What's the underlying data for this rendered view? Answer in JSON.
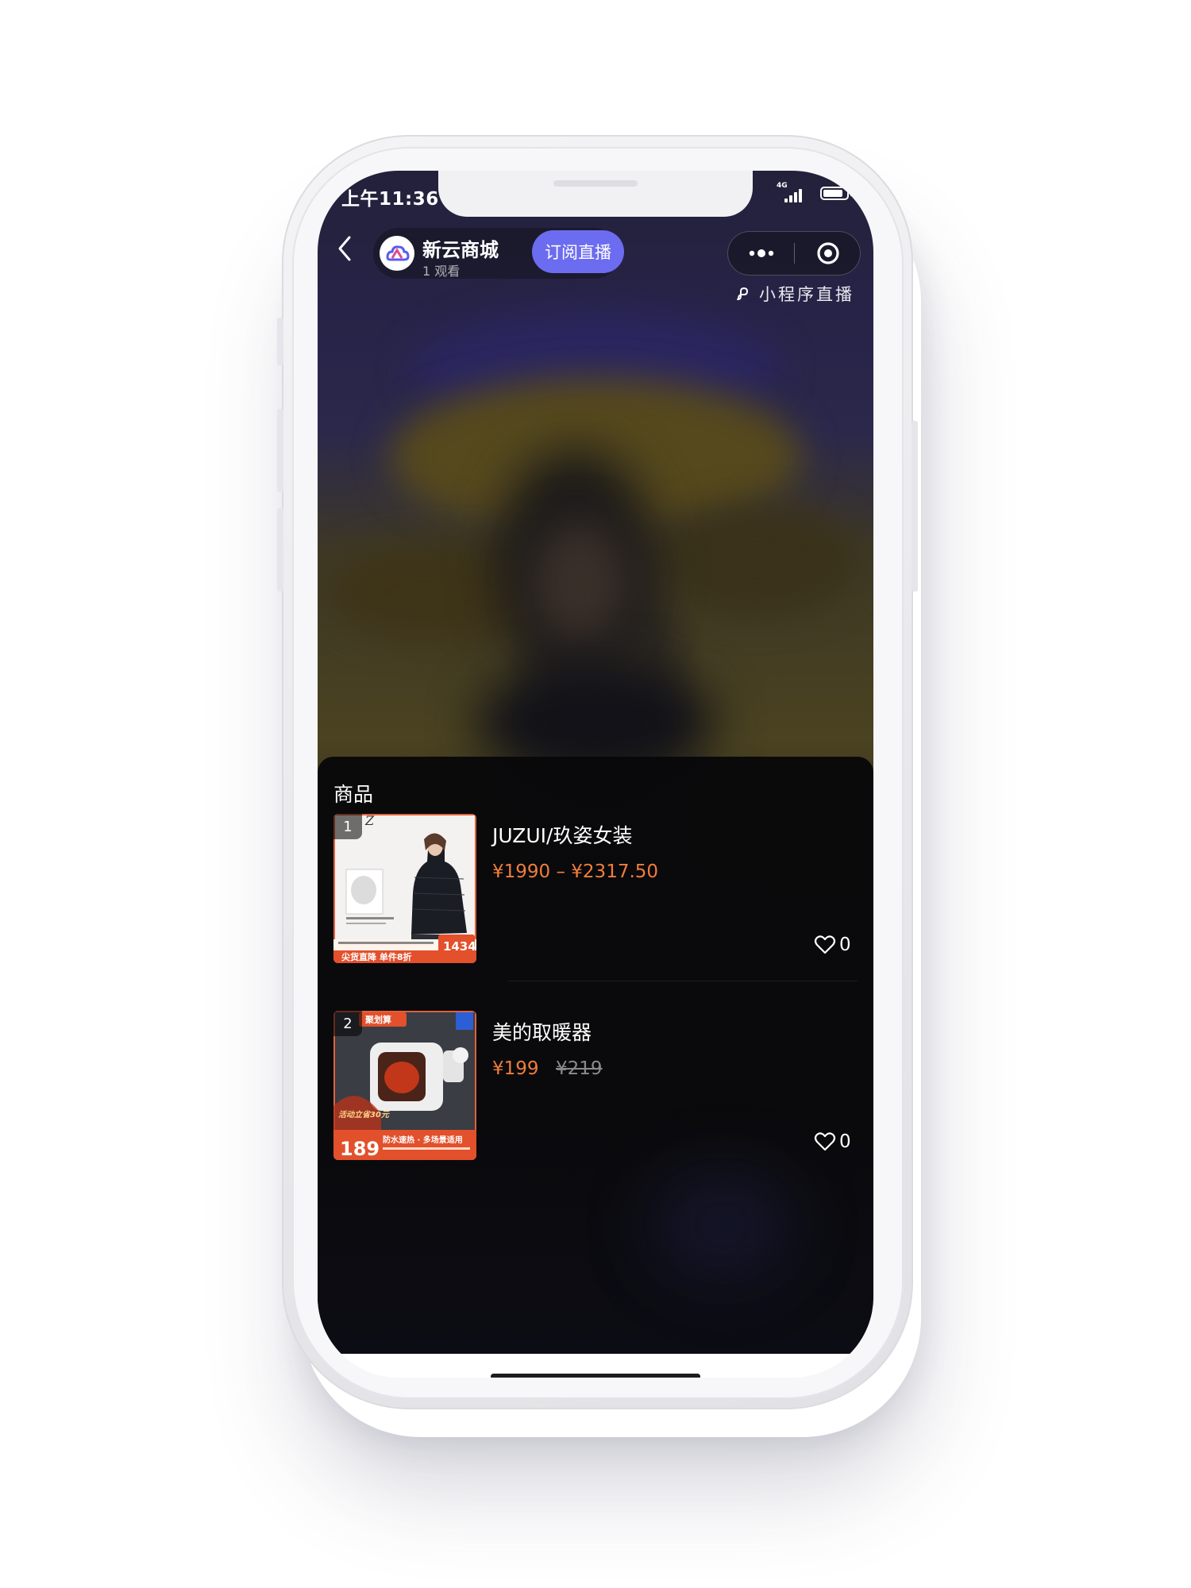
{
  "status_bar": {
    "time": "上午11:36",
    "network": "4G",
    "battery_level": 0.85
  },
  "header": {
    "host_name": "新云商城",
    "viewers": "1 观看",
    "subscribe_label": "订阅直播",
    "mini_program_label": "小程序直播"
  },
  "panel": {
    "title": "商品",
    "products": [
      {
        "rank": "1",
        "name": "JUZUI/玖姿女装",
        "price": "¥1990 – ¥2317.50",
        "old_price": "",
        "likes": "0",
        "thumb_banner": "尖货直降 单件8折",
        "thumb_price": "1434"
      },
      {
        "rank": "2",
        "name": "美的取暖器",
        "price": "¥199",
        "old_price": "¥219",
        "likes": "0",
        "thumb_badge": "聚划算",
        "thumb_price": "189",
        "thumb_slogan": "防水速热 · 多场景适用",
        "thumb_promo": "活动立省30元"
      }
    ]
  },
  "colors": {
    "accent": "#6c6cf0",
    "price": "#f07d3c",
    "panel_bg": "#0a0a0c"
  }
}
